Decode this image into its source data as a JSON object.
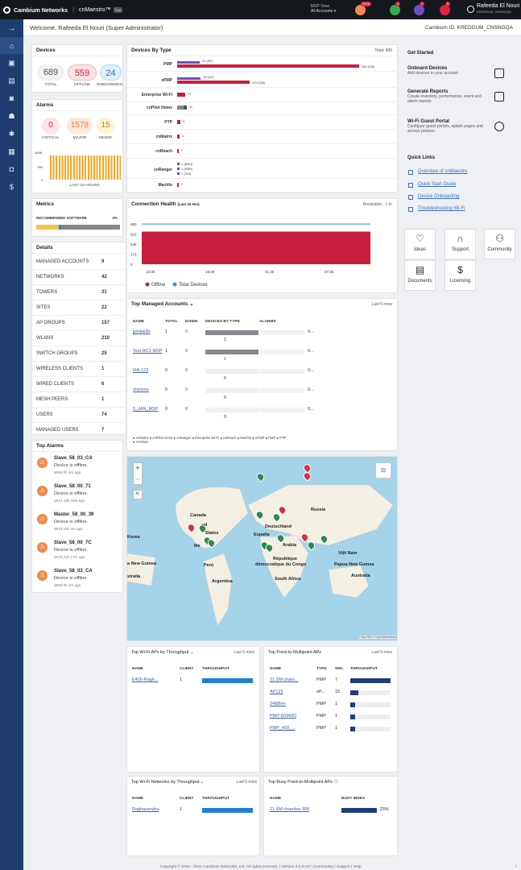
{
  "topbar": {
    "brand": "Cambium Networks",
    "product": "cnMaestro",
    "tm": "™",
    "trial": "Trial",
    "msp_view": "MSP View",
    "all_accounts": "All Accounts ▾",
    "badges": [
      "1578",
      "1",
      "1",
      "0"
    ],
    "user_name": "Rafeeda El Nouri",
    "user_id": "KREDDUM_CNSNGQA"
  },
  "welcome": {
    "text": "Welcome, Rafeeda El Nouri (Super Administrator)",
    "cambium_id": "Cambium ID: KREDDUM_CNSNGQA"
  },
  "devices": {
    "title": "Devices",
    "total": "689",
    "total_label": "TOTAL",
    "offline": "559",
    "offline_label": "OFFLINE",
    "onboarding": "24",
    "onboarding_label": "ONBOARDING"
  },
  "alarms": {
    "title": "Alarms",
    "critical": "0",
    "critical_label": "CRITICAL",
    "major": "1578",
    "major_label": "MAJOR",
    "minor": "15",
    "minor_label": "MINOR",
    "ymax": "1598",
    "ymid": "799",
    "yzero": "0",
    "footer": "LAST 24 HOURS"
  },
  "metrics": {
    "title": "Metrics",
    "label": "RECOMMENDED SOFTWARE",
    "value": "2%",
    "fraction": 0.02
  },
  "details": {
    "title": "Details",
    "rows": [
      {
        "k": "MANAGED ACCOUNTS",
        "v": "9"
      },
      {
        "k": "NETWORKS",
        "v": "42"
      },
      {
        "k": "TOWERS",
        "v": "31"
      },
      {
        "k": "SITES",
        "v": "22"
      },
      {
        "k": "AP GROUPS",
        "v": "157"
      },
      {
        "k": "WLANS",
        "v": "210"
      },
      {
        "k": "SWITCH GROUPS",
        "v": "25"
      },
      {
        "k": "WIRELESS CLIENTS",
        "v": "1"
      },
      {
        "k": "WIRED CLIENTS",
        "v": "6"
      },
      {
        "k": "MESH PEERS",
        "v": "1"
      },
      {
        "k": "USERS",
        "v": "74"
      },
      {
        "k": "MANAGED USERS",
        "v": "7"
      }
    ]
  },
  "top_alarms": {
    "title": "Top Alarms",
    "items": [
      {
        "name": "Slave_58_03_CA",
        "msg": "Device is offline.",
        "time": "689d 0h 3m ago"
      },
      {
        "name": "Slave_58_00_71",
        "msg": "Device is offline.",
        "time": "691d 18h 26m ago"
      },
      {
        "name": "Master_58_00_39",
        "msg": "Device is offline.",
        "time": "597d 18h 4m ago"
      },
      {
        "name": "Slave_58_00_7C",
        "msg": "Device is offline.",
        "time": "597d 21h 17m ago"
      },
      {
        "name": "Slave_58_03_CA",
        "msg": "Device is offline.",
        "time": "689d 0h 3m ago"
      }
    ]
  },
  "devices_by_type": {
    "title": "Devices By Type",
    "total": "Total: 689",
    "rows": [
      {
        "label": "PMP",
        "l1": "24 (AP)",
        "l2": "389 (SM)"
      },
      {
        "label": "ePMP",
        "l1": "25 (AP)",
        "l2": "194 (SM)"
      },
      {
        "label": "Enterprise Wi-Fi",
        "l1": "27"
      },
      {
        "label": "cnPilot Home",
        "l1": "11"
      },
      {
        "label": "PTP",
        "l1": "9"
      },
      {
        "label": "cnMatrix",
        "l1": "4"
      },
      {
        "label": "cnReach",
        "l1": "2"
      },
      {
        "label": "cnRanger",
        "l1": "1 (BBU)",
        "l2": "1 (RBH)",
        "l3": "1 (SM)"
      },
      {
        "label": "Machfu",
        "l1": "1"
      }
    ]
  },
  "connection": {
    "title": "Connection Health",
    "subtitle": "(Last 24 Hrs)",
    "resolution": "Resolution : 1 hr",
    "y": [
      "690",
      "519",
      "346",
      "173",
      "0"
    ],
    "x": [
      "13:30",
      "19:30",
      "01:30",
      "07:30"
    ],
    "legend_offline": "Offline",
    "legend_total": "Total Devices"
  },
  "chart_data": {
    "type": "area",
    "title": "Connection Health",
    "series": [
      {
        "name": "Offline",
        "values": [
          559,
          559,
          559,
          559
        ]
      },
      {
        "name": "Total Devices",
        "values": [
          689,
          689,
          689,
          689
        ]
      }
    ],
    "categories": [
      "13:30",
      "19:30",
      "01:30",
      "07:30"
    ],
    "ylim": [
      0,
      690
    ]
  },
  "managed": {
    "title": "Top Managed Accounts",
    "chevron": "⌄",
    "range": "Last 5 mins",
    "cols": [
      "NAME",
      "TOTAL",
      "DOWN",
      "DEVICES BY TYPE",
      "ALARMS"
    ],
    "rows": [
      {
        "name": "jjsh&&$#",
        "total": "1",
        "down": "0",
        "dev": "1",
        "al": "0..."
      },
      {
        "name": "Test-AC1-MSP",
        "total": "1",
        "down": "0",
        "dev": "1",
        "al": "0..."
      },
      {
        "name": "MA-123",
        "total": "0",
        "down": "0",
        "dev": "0",
        "al": "0..."
      },
      {
        "name": "shemna",
        "total": "0",
        "down": "0",
        "dev": "0",
        "al": "0..."
      },
      {
        "name": "6_JAN_MSP",
        "total": "0",
        "down": "0",
        "dev": "0",
        "al": "0..."
      }
    ],
    "legend": "● cnMatrix ● cnPilot Home ● cnRanger ● Enterprise Wi-Fi ● cnReach ● Machfu ● ePMP ● PMP ● PTP",
    "legend2": "● cnVision"
  },
  "map": {
    "labels": [
      "Canada",
      "Russia",
      "Deutschland",
      "España",
      "Korea",
      "Arabia",
      "Việt Nam",
      "République",
      "démocratique du Congo",
      "Papua New Guinea",
      "a New Guinea",
      "South Africa",
      "Australia",
      "Perú",
      "Argentina",
      "stralia",
      "Me",
      "ed",
      "States"
    ],
    "credit": "© MapTiler © OpenStreetMap",
    "zoom_in": "+",
    "zoom_out": "–"
  },
  "wifi_aps": {
    "title": "Top Wi-Fi APs by Throughput",
    "chevron": "⌄",
    "range": "Last 5 mins",
    "cols": [
      "NAME",
      "CLIENT",
      "THROUGHPUT"
    ],
    "rows": [
      {
        "name": "E400-Ragh...",
        "client": "1",
        "tp": 1.0
      }
    ]
  },
  "ptmp": {
    "title": "Top Point-to-Multipoint APs",
    "range": "Last 5 mins",
    "cols": [
      "NAME",
      "TYPE",
      "SMs",
      "THROUGHPUT"
    ],
    "rows": [
      {
        "name": "21 SM cham...",
        "type": "PMP",
        "sms": "7",
        "tp": 1.0
      },
      {
        "name": "AP125",
        "type": "eP...",
        "sms": "15",
        "tp": 0.2
      },
      {
        "name": "2488hm",
        "type": "PMP",
        "sms": "1",
        "tp": 0.12
      },
      {
        "name": "PMP-60342D",
        "type": "PMP",
        "sms": "1",
        "tp": 0.12
      },
      {
        "name": "PMP_450_...",
        "type": "PMP",
        "sms": "1",
        "tp": 0.12
      }
    ]
  },
  "wifi_nets": {
    "title": "Top Wi-Fi Networks by Throughput",
    "chevron": "⌄",
    "range": "Last 5 mins",
    "cols": [
      "NAME",
      "CLIENT",
      "THROUGHPUT"
    ],
    "rows": [
      {
        "name": "Raghavendra",
        "client": "1",
        "tp": 1.0
      }
    ]
  },
  "busy": {
    "title": "Top Busy Point-to-Multipoint APs",
    "info": "ⓘ",
    "cols": [
      "NAME",
      "BUSY INDEX"
    ],
    "rows": [
      {
        "name": "21 SM chamber RM",
        "idx": "23%",
        "frac": 0.23
      }
    ]
  },
  "get_started": {
    "title": "Get Started",
    "items": [
      {
        "h": "Onboard Devices",
        "d": "Add devices to your account"
      },
      {
        "h": "Generate Reports",
        "d": "Create inventory, performance, event and alarm reports"
      },
      {
        "h": "Wi-Fi Guest Portal",
        "d": "Configure guest portals, splash pages and access policies"
      }
    ]
  },
  "quick_links": {
    "title": "Quick Links",
    "items": [
      "Overview of cnMaestro",
      "Quick Start Guide",
      "Device Onboarding",
      "Troubleshooting Wi-Fi"
    ]
  },
  "tiles": [
    {
      "label": "Ideas",
      "icon": "lightbulb-icon",
      "glyph": "💡"
    },
    {
      "label": "Support",
      "icon": "headset-icon",
      "glyph": "🎧"
    },
    {
      "label": "Community",
      "icon": "people-icon",
      "glyph": "👥"
    },
    {
      "label": "Documents",
      "icon": "document-icon",
      "glyph": "📄"
    },
    {
      "label": "Licensing",
      "icon": "licensing-icon",
      "glyph": "$"
    }
  ],
  "footer": "Copyright © 2015 - 2021 Cambium Networks, Ltd. All rights reserved. | Version 3.0.0-r37 | Community | Support | Help"
}
